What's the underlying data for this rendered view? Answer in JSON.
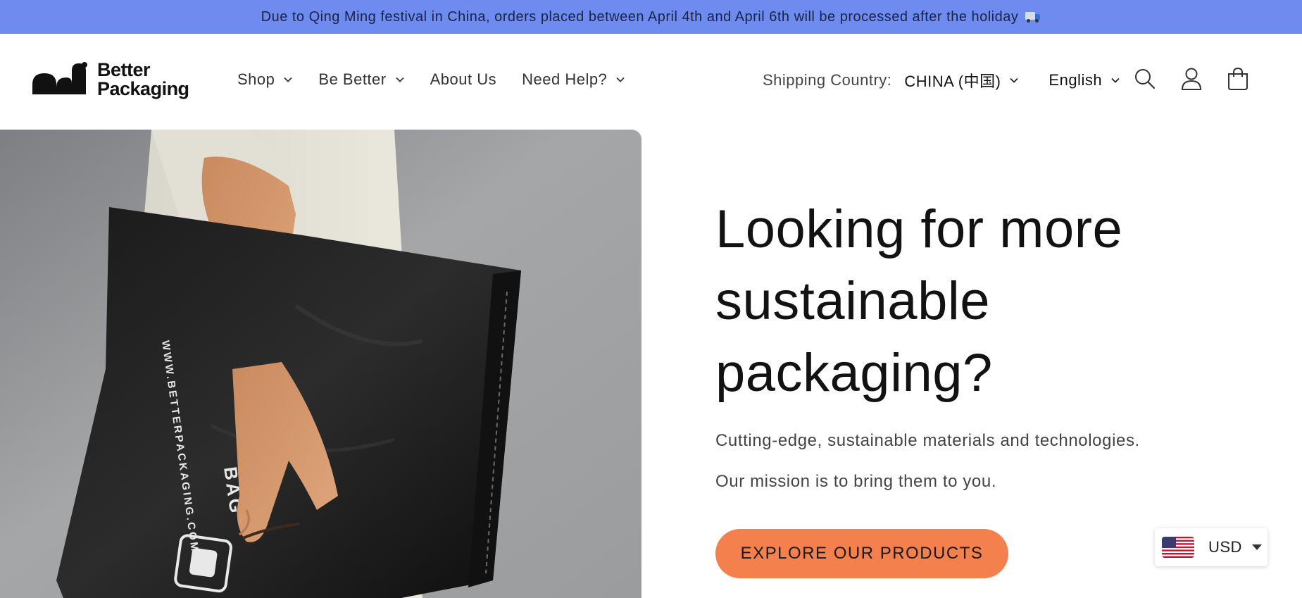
{
  "announcement": {
    "text": "Due to Qing Ming festival in China, orders placed between April 4th and April 6th will be processed after the holiday",
    "icon": "truck-icon"
  },
  "header": {
    "logo": {
      "line1": "Better",
      "line2": "Packaging"
    },
    "nav": [
      {
        "label": "Shop",
        "has_dropdown": true
      },
      {
        "label": "Be Better",
        "has_dropdown": true
      },
      {
        "label": "About Us",
        "has_dropdown": false
      },
      {
        "label": "Need Help?",
        "has_dropdown": true
      }
    ],
    "shipping_label": "Shipping Country:",
    "country": "CHINA (中国)",
    "language": "English",
    "icons": [
      "search-icon",
      "account-icon",
      "cart-icon"
    ]
  },
  "hero": {
    "title": "Looking for more sustainable packaging?",
    "subtitle1": "Cutting-edge, sustainable materials and technologies.",
    "subtitle2": "Our mission is to bring them to you.",
    "cta_label": "EXPLORE OUR PRODUCTS",
    "bag_texts": {
      "brand": "WWW.BETTERPACKAGING.COM",
      "bag": "BAG"
    }
  },
  "currency": {
    "code": "USD",
    "flag": "us-flag-icon"
  },
  "colors": {
    "announcement_bg": "#6e8cf0",
    "cta_bg": "#f3804d",
    "text": "#121212"
  }
}
